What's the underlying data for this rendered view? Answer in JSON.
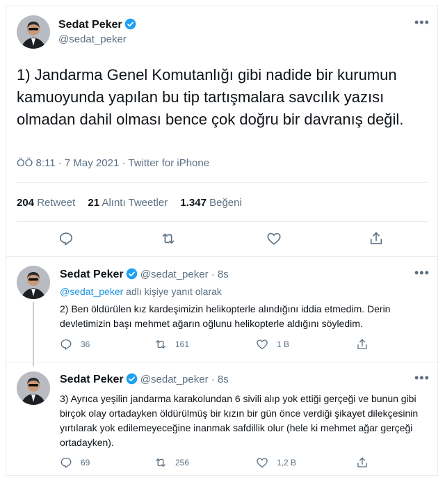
{
  "main_tweet": {
    "author_name": "Sedat Peker",
    "author_handle": "@sedat_peker",
    "more_icon": "more-icon",
    "text": "1) Jandarma Genel Komutanlığı gibi nadide bir kurumun kamuoyunda yapılan bu tip tartışmalara savcılık yazısı olmadan dahil olması bence çok doğru bir davranış değil.",
    "meta": "ÖÖ 8:11 · 7 May 2021 · Twitter for iPhone",
    "stats": {
      "retweets_count": "204",
      "retweets_label": "Retweet",
      "quotes_count": "21",
      "quotes_label": "Alıntı Tweetler",
      "likes_count": "1.347",
      "likes_label": "Beğeni"
    }
  },
  "replies": [
    {
      "author_name": "Sedat Peker",
      "author_handle": "@sedat_peker",
      "time": "· 8s",
      "reply_to_handle": "@sedat_peker",
      "reply_to_suffix": "adlı kişiye yanıt olarak",
      "text": "2) Ben öldürülen kız kardeşimizin helikopterle alındığını iddia etmedim. Derin devletimizin başı mehmet ağarın oğlunu helikopterle aldığını söyledim.",
      "reply_count": "36",
      "retweet_count": "161",
      "like_count": "1 B"
    },
    {
      "author_name": "Sedat Peker",
      "author_handle": "@sedat_peker",
      "time": "· 8s",
      "text": "3) Ayrıca yeşilin jandarma karakolundan 6 sivili alıp yok ettiği gerçeği ve bunun gibi birçok olay ortadayken öldürülmüş bir kızın bir gün önce verdiği şikayet dilekçesinin yırtılarak yok edilemeyeceğine inanmak safdillik olur (hele ki mehmet ağar gerçeği ortadayken).",
      "reply_count": "69",
      "retweet_count": "256",
      "like_count": "1,2 B"
    }
  ],
  "colors": {
    "verified": "#1da1f2",
    "text": "#0f1419",
    "secondary": "#5b7083",
    "link": "#1b95e0",
    "border": "#e6ecf0"
  }
}
